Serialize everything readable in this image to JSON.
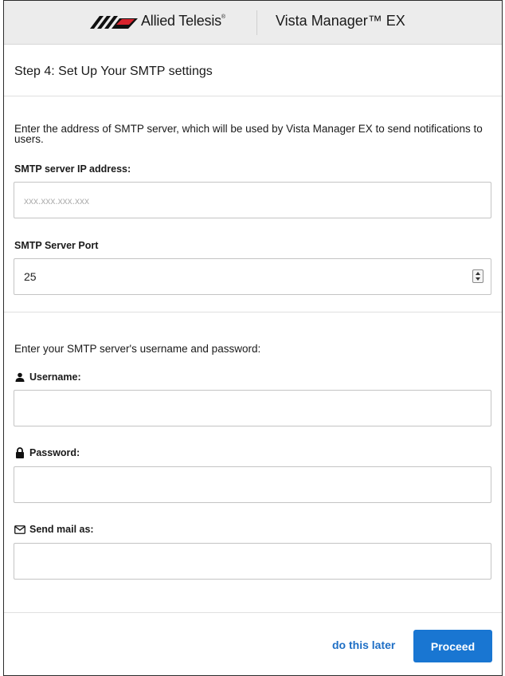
{
  "header": {
    "brand_name": "Allied Telesis",
    "brand_mark": "®",
    "product_name": "Vista Manager™ EX"
  },
  "step": {
    "title": "Step 4: Set Up Your SMTP settings"
  },
  "smtp": {
    "intro": "Enter the address of SMTP server, which will be used by Vista Manager EX to send notifications to users.",
    "ip_label": "SMTP server IP address:",
    "ip_placeholder": "xxx.xxx.xxx.xxx",
    "ip_value": "",
    "port_label": "SMTP Server Port",
    "port_value": "25"
  },
  "credentials": {
    "intro": "Enter your SMTP server's username and password:",
    "username_label": "Username:",
    "username_icon": "user-icon",
    "username_value": "",
    "password_label": "Password:",
    "password_icon": "lock-icon",
    "password_value": "",
    "sendas_label": "Send mail as:",
    "sendas_icon": "envelope-icon",
    "sendas_value": ""
  },
  "footer": {
    "later_label": "do this later",
    "proceed_label": "Proceed"
  },
  "colors": {
    "accent": "#1976d2",
    "link": "#1f6fc5",
    "header_bg": "#ececec"
  }
}
